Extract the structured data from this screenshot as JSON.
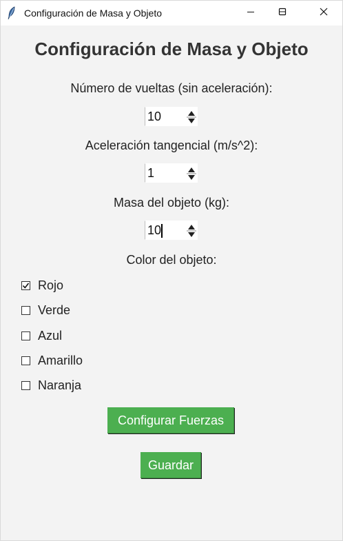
{
  "window": {
    "title": "Configuración de Masa y Objeto",
    "controls": {
      "minimize_icon": "minimize-icon",
      "maximize_icon": "maximize-icon",
      "close_icon": "close-icon"
    }
  },
  "main": {
    "heading": "Configuración de Masa y Objeto",
    "fields": [
      {
        "label": "Número de vueltas (sin aceleración):",
        "value": "10"
      },
      {
        "label": "Aceleración tangencial (m/s^2):",
        "value": "1"
      },
      {
        "label": "Masa del objeto (kg):",
        "value": "10"
      }
    ],
    "color_label": "Color del objeto:",
    "colors": [
      {
        "label": "Rojo",
        "checked": true
      },
      {
        "label": "Verde",
        "checked": false
      },
      {
        "label": "Azul",
        "checked": false
      },
      {
        "label": "Amarillo",
        "checked": false
      },
      {
        "label": "Naranja",
        "checked": false
      }
    ],
    "configure_button": "Configurar Fuerzas",
    "save_button": "Guardar"
  },
  "colors": {
    "button_green": "#4caf50",
    "background": "#f3f3f3"
  }
}
